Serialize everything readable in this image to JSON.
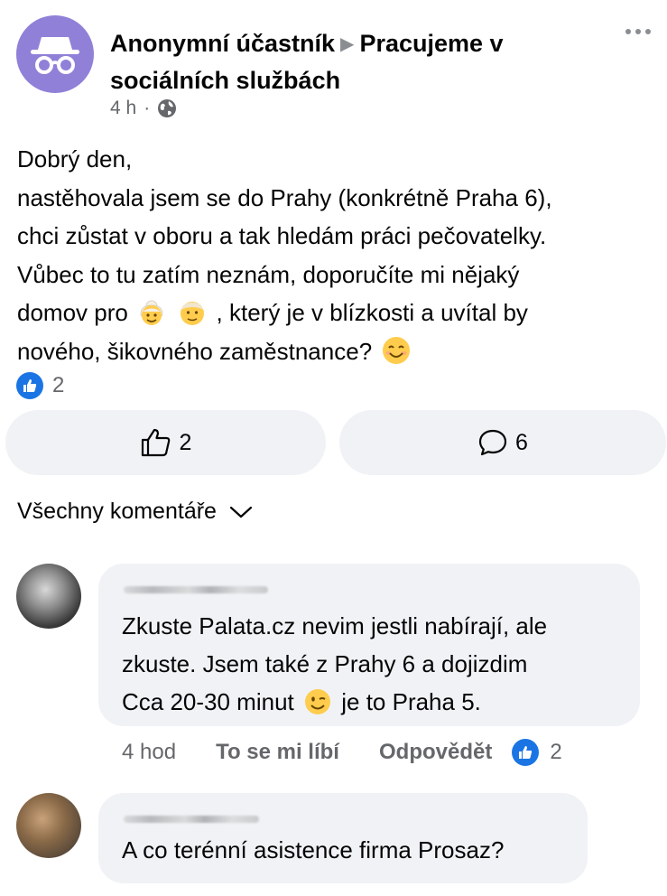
{
  "post": {
    "author": "Anonymní účastník",
    "group": "Pracujeme v sociálních službách",
    "time": "4 h",
    "separator": "·",
    "audience_icon": "globe-icon",
    "body_lines": [
      "Dobrý den,",
      "nastěhovala jsem se do Prahy (konkrétně Praha 6),",
      "chci zůstat v oboru a tak hledám práci pečovatelky.",
      "Vůbec to tu zatím neznám, doporučíte mi nějaký"
    ],
    "line5_before": "domov pro",
    "line5_after": ", který je v blízkosti a uvítal by",
    "line6": "nového, šikovného zaměstnance?",
    "reaction_count": "2"
  },
  "actions": {
    "like_count": "2",
    "comment_count": "6"
  },
  "comments_filter": "Všechny komentáře",
  "comments": [
    {
      "line1": "Zkuste Palata.cz nevim jestli nabírají, ale",
      "line2": "zkuste. Jsem také z Prahy 6 a dojizdim",
      "line3_before": "Cca 20-30 minut",
      "line3_after": "je to Praha 5.",
      "time": "4 hod",
      "like_label": "To se mi líbí",
      "reply_label": "Odpovědět",
      "reaction_count": "2"
    },
    {
      "text": "A co terénní asistence firma Prosaz?"
    }
  ],
  "colors": {
    "avatar_purple": "#9180d8",
    "like_blue": "#1b74e4",
    "bubble_gray": "#f0f2f5",
    "secondary_text": "#65676b"
  }
}
